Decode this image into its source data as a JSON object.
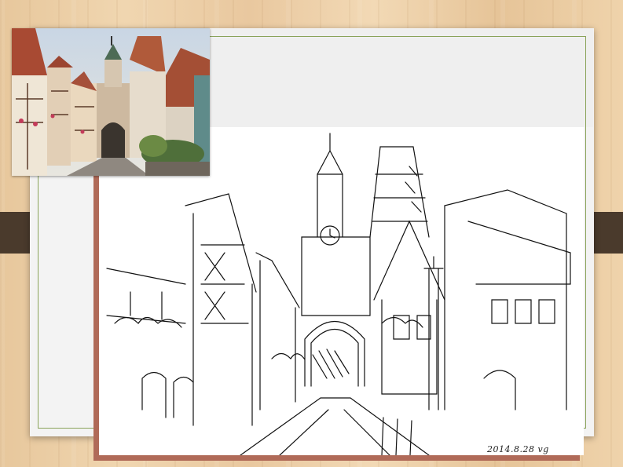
{
  "slide": {
    "signature": "2014.8.28 vg",
    "colors": {
      "background_wood": "#e9c89f",
      "side_bar": "#4a3a2c",
      "slide_border": "#8aa35a",
      "sketch_shadow": "#b06a58"
    }
  },
  "images": {
    "photo": {
      "icon": "street-photo-icon"
    },
    "sketch": {
      "icon": "pen-sketch-icon"
    }
  }
}
